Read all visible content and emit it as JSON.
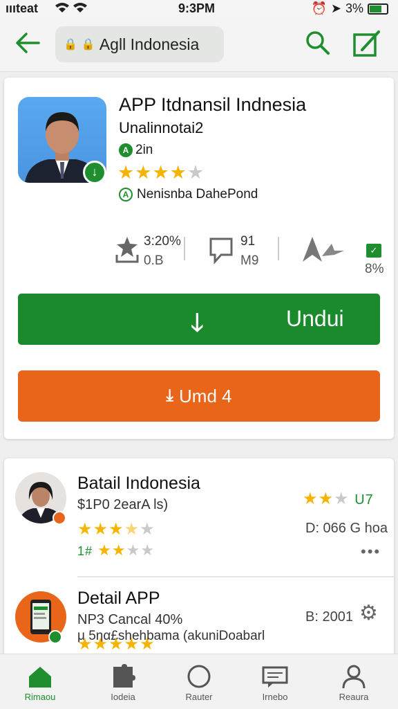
{
  "status_bar": {
    "carrier": "ıııteat",
    "time": "9:3PM",
    "battery": "3%",
    "battery_level": 0.7
  },
  "header": {
    "url_text": "Agll Indonesia"
  },
  "app": {
    "title": "APP Itdnansil Indnesia",
    "developer": "Unalinnotai2",
    "size": "2in",
    "rating": 4,
    "tag": "Nenisnba DahePond",
    "stats": {
      "rating_value": "3:20%",
      "rating_sub": "0.B",
      "reviews_value": "91",
      "reviews_sub": "M9",
      "extra_value": "8%"
    },
    "install_label": "Undui",
    "secondary_label": "Umd 4"
  },
  "list": [
    {
      "title": "Batail Indonesia",
      "subtitle": "$1P0 2earA ls)",
      "rating": 3.5,
      "top_rating": 2,
      "top_value": "U7",
      "meta": "D: 066 G hoa",
      "secondary_rating": 2,
      "secondary_prefix": "1#"
    },
    {
      "title": "Detail APP",
      "subtitle": "NP3 Cancal 40%",
      "subtitle2": "μ 5ηα£shehbama (akuniDoabarl",
      "rating": 5,
      "meta": "B: 2001"
    }
  ],
  "bottom_nav": [
    {
      "label": "Rimaou",
      "icon": "home-icon"
    },
    {
      "label": "Iodeia",
      "icon": "puzzle-icon"
    },
    {
      "label": "Rauter",
      "icon": "compass-icon"
    },
    {
      "label": "Irnebo",
      "icon": "chat-icon"
    },
    {
      "label": "Reaura",
      "icon": "person-icon"
    }
  ],
  "colors": {
    "accent": "#1b8a2c",
    "orange": "#e8651a",
    "star": "#f4b400"
  }
}
